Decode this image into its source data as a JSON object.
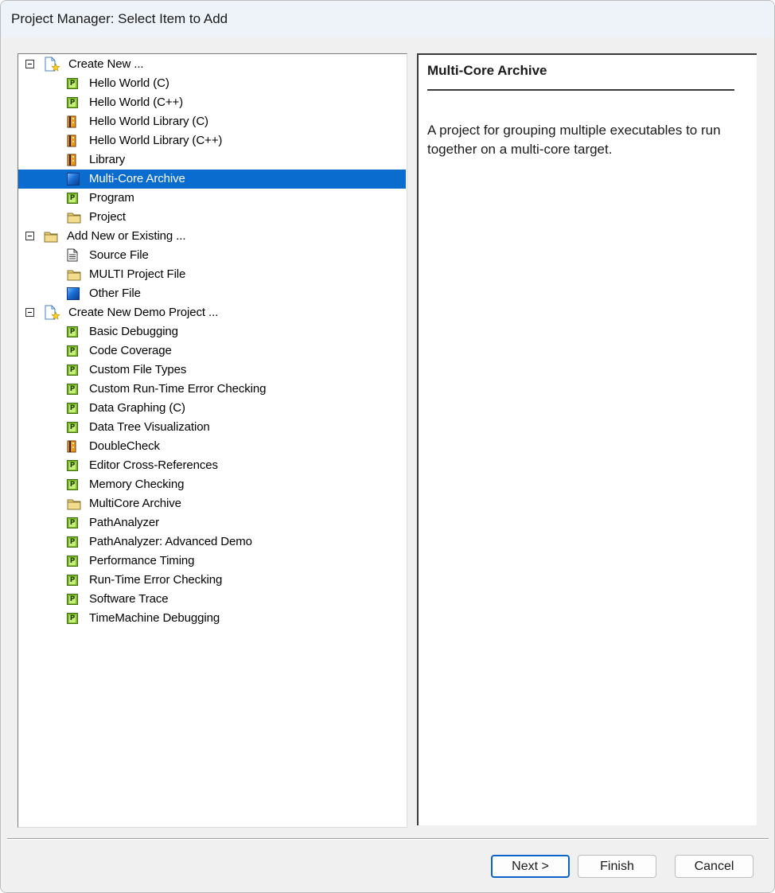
{
  "window": {
    "title": "Project Manager: Select Item to Add"
  },
  "tree": {
    "rows": [
      {
        "label": "Create New ...",
        "icon": "new-document-icon",
        "level": 0,
        "expanded": true
      },
      {
        "label": "Hello World (C)",
        "icon": "program-icon",
        "level": 1
      },
      {
        "label": "Hello World (C++)",
        "icon": "program-icon",
        "level": 1
      },
      {
        "label": "Hello World Library (C)",
        "icon": "library-icon",
        "level": 1
      },
      {
        "label": "Hello World Library (C++)",
        "icon": "library-icon",
        "level": 1
      },
      {
        "label": "Library",
        "icon": "library-icon",
        "level": 1
      },
      {
        "label": "Multi-Core Archive",
        "icon": "archive-icon",
        "level": 1,
        "selected": true
      },
      {
        "label": "Program",
        "icon": "program-icon",
        "level": 1
      },
      {
        "label": "Project",
        "icon": "folder-icon",
        "level": 1
      },
      {
        "label": "Add New or Existing ...",
        "icon": "folder-icon",
        "level": 0,
        "expanded": true
      },
      {
        "label": "Source File",
        "icon": "source-file-icon",
        "level": 1
      },
      {
        "label": "MULTI Project File",
        "icon": "folder-icon",
        "level": 1
      },
      {
        "label": "Other File",
        "icon": "archive-icon",
        "level": 1
      },
      {
        "label": "Create New Demo Project ...",
        "icon": "new-document-icon",
        "level": 0,
        "expanded": true
      },
      {
        "label": "Basic Debugging",
        "icon": "program-icon",
        "level": 1
      },
      {
        "label": "Code Coverage",
        "icon": "program-icon",
        "level": 1
      },
      {
        "label": "Custom File Types",
        "icon": "program-icon",
        "level": 1
      },
      {
        "label": "Custom Run-Time Error Checking",
        "icon": "program-icon",
        "level": 1
      },
      {
        "label": "Data Graphing (C)",
        "icon": "program-icon",
        "level": 1
      },
      {
        "label": "Data Tree Visualization",
        "icon": "program-icon",
        "level": 1
      },
      {
        "label": "DoubleCheck",
        "icon": "library-icon",
        "level": 1
      },
      {
        "label": "Editor Cross-References",
        "icon": "program-icon",
        "level": 1
      },
      {
        "label": "Memory Checking",
        "icon": "program-icon",
        "level": 1
      },
      {
        "label": "MultiCore Archive",
        "icon": "folder-icon",
        "level": 1
      },
      {
        "label": "PathAnalyzer",
        "icon": "program-icon",
        "level": 1
      },
      {
        "label": "PathAnalyzer: Advanced Demo",
        "icon": "program-icon",
        "level": 1
      },
      {
        "label": "Performance Timing",
        "icon": "program-icon",
        "level": 1
      },
      {
        "label": "Run-Time Error Checking",
        "icon": "program-icon",
        "level": 1
      },
      {
        "label": "Software Trace",
        "icon": "program-icon",
        "level": 1
      },
      {
        "label": "TimeMachine Debugging",
        "icon": "program-icon",
        "level": 1
      }
    ]
  },
  "description": {
    "title": "Multi-Core Archive",
    "text": "A project for grouping multiple executables to run together on a multi-core target."
  },
  "buttons": {
    "next": "Next >",
    "finish": "Finish",
    "cancel": "Cancel"
  },
  "colors": {
    "selection": "#0a6ccf",
    "default_button_border": "#0a64c8"
  }
}
